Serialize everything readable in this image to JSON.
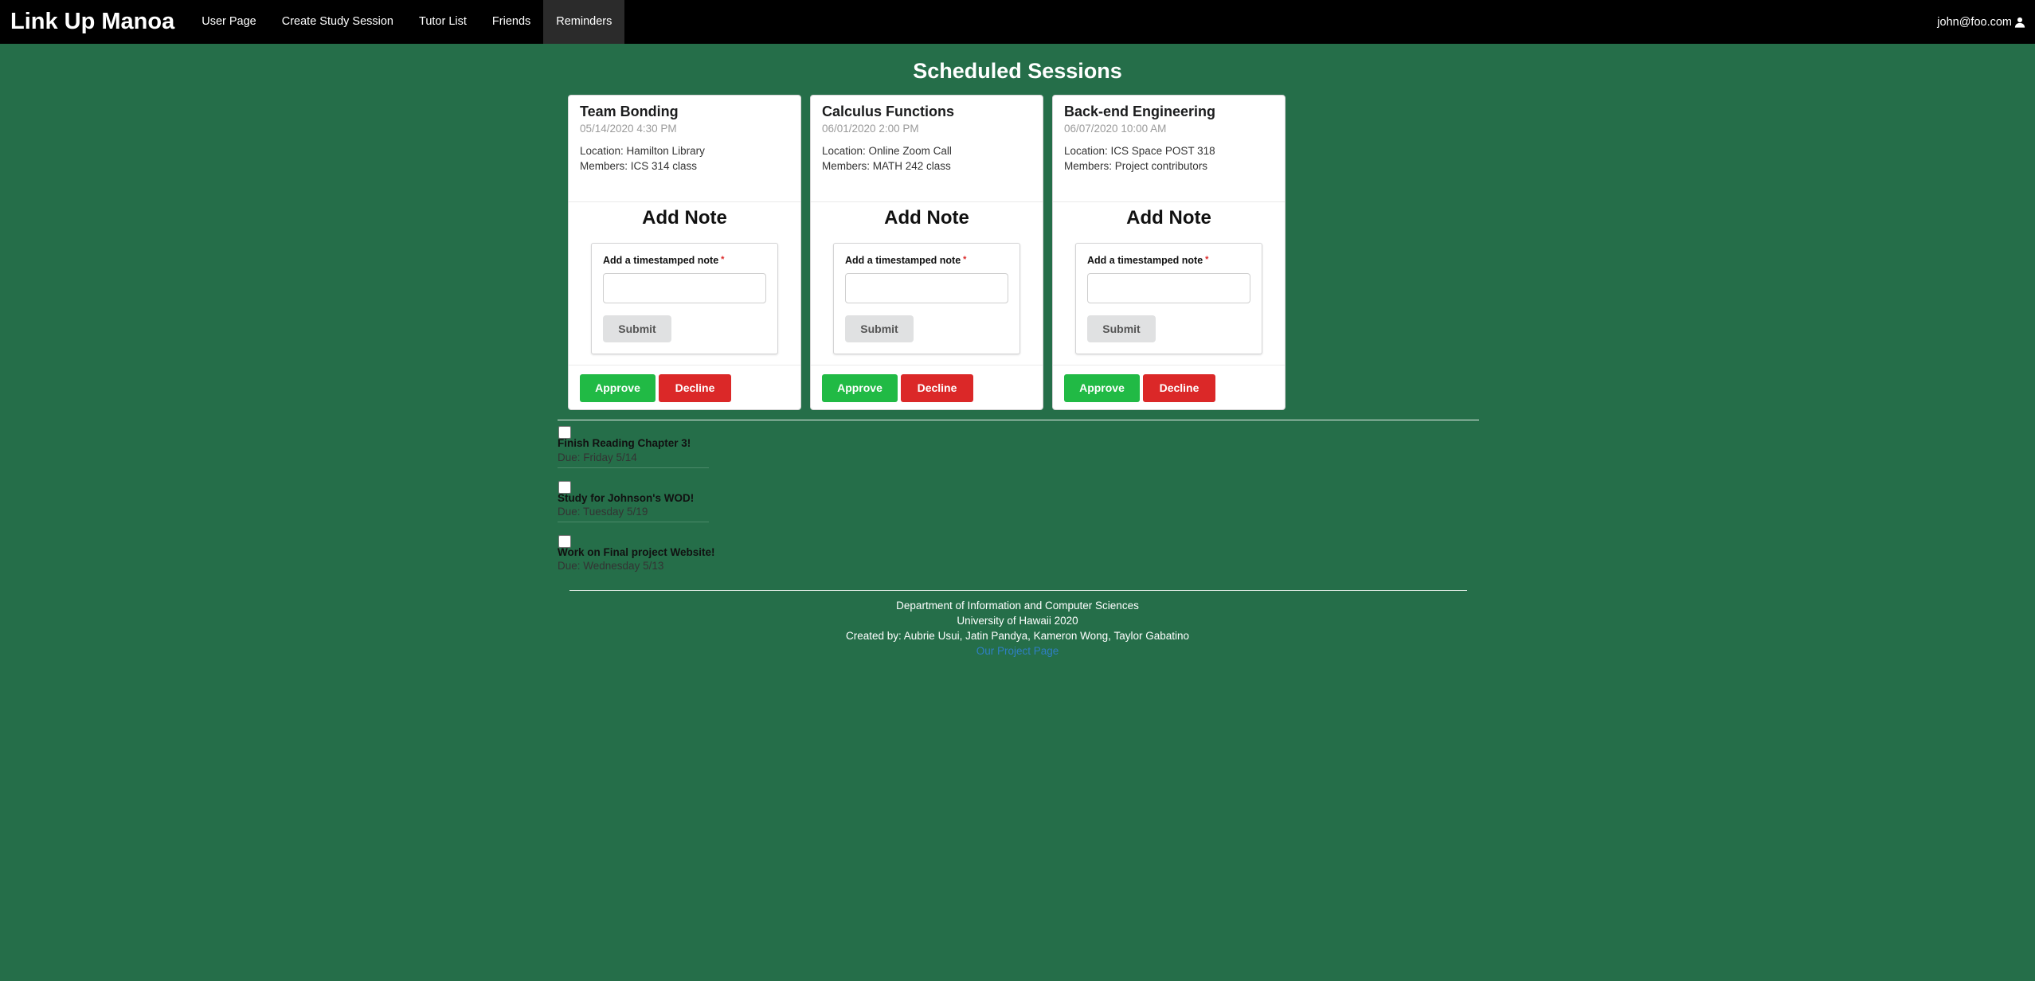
{
  "nav": {
    "brand": "Link Up Manoa",
    "items": [
      {
        "label": "User Page"
      },
      {
        "label": "Create Study Session"
      },
      {
        "label": "Tutor List"
      },
      {
        "label": "Friends"
      },
      {
        "label": "Reminders",
        "active": true
      }
    ],
    "user": "john@foo.com",
    "user_icon": "user-icon"
  },
  "page_title": "Scheduled Sessions",
  "sessions": [
    {
      "title": "Team Bonding",
      "datetime": "05/14/2020 4:30 PM",
      "location": "Location: Hamilton Library",
      "members": "Members: ICS 314 class",
      "note_heading": "Add Note",
      "note_label": "Add a timestamped note",
      "note_value": "",
      "submit": "Submit",
      "approve": "Approve",
      "decline": "Decline"
    },
    {
      "title": "Calculus Functions",
      "datetime": "06/01/2020 2:00 PM",
      "location": "Location: Online Zoom Call",
      "members": "Members: MATH 242 class",
      "note_heading": "Add Note",
      "note_label": "Add a timestamped note",
      "note_value": "",
      "submit": "Submit",
      "approve": "Approve",
      "decline": "Decline"
    },
    {
      "title": "Back-end Engineering",
      "datetime": "06/07/2020 10:00 AM",
      "location": "Location: ICS Space POST 318",
      "members": "Members: Project contributors",
      "note_heading": "Add Note",
      "note_label": "Add a timestamped note",
      "note_value": "",
      "submit": "Submit",
      "approve": "Approve",
      "decline": "Decline"
    }
  ],
  "reminders": [
    {
      "title": "Finish Reading Chapter 3!",
      "due": "Due: Friday 5/14",
      "checked": false
    },
    {
      "title": "Study for Johnson's WOD!",
      "due": "Due: Tuesday 5/19",
      "checked": false
    },
    {
      "title": "Work on Final project Website!",
      "due": "Due: Wednesday 5/13",
      "checked": false
    }
  ],
  "footer": {
    "line1": "Department of Information and Computer Sciences",
    "line2": "University of Hawaii 2020",
    "line3": "Created by: Aubrie Usui, Jatin Pandya, Kameron Wong, Taylor Gabatino",
    "link": "Our Project Page"
  },
  "colors": {
    "background": "#256e49",
    "approve": "#21ba45",
    "decline": "#db2828",
    "link": "#2f7fc4"
  }
}
